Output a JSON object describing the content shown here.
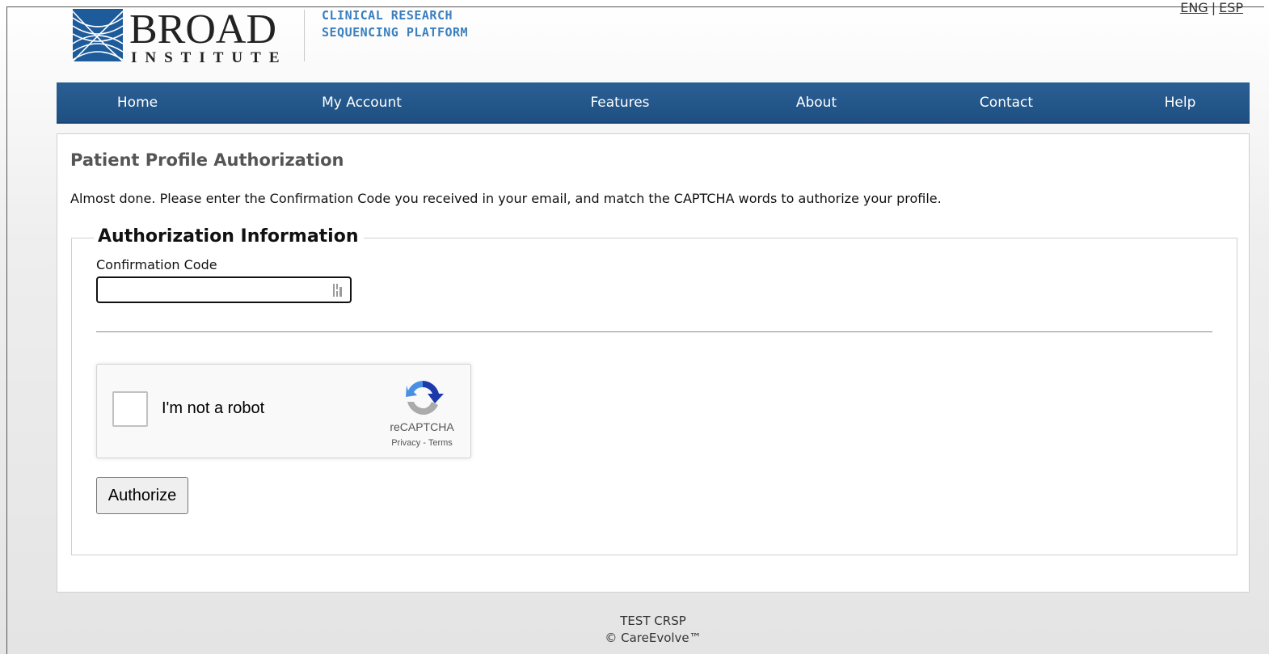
{
  "header": {
    "logo_word": "BROAD",
    "logo_subword": "INSTITUTE",
    "platform_line1": "CLINICAL RESEARCH",
    "platform_line2": "SEQUENCING PLATFORM",
    "lang_eng": "ENG",
    "lang_separator": "|",
    "lang_esp": "ESP"
  },
  "nav": {
    "items": [
      {
        "label": "Home"
      },
      {
        "label": "My Account"
      },
      {
        "label": "Features"
      },
      {
        "label": "About"
      },
      {
        "label": "Contact"
      },
      {
        "label": "Help"
      }
    ]
  },
  "main": {
    "title": "Patient Profile Authorization",
    "intro": "Almost done. Please enter the Confirmation Code you received in your email, and match the CAPTCHA words to authorize your profile.",
    "fieldset_legend": "Authorization Information",
    "confirmation_label": "Confirmation Code",
    "confirmation_value": "",
    "input_badge_icon": "password-manager-icon",
    "recaptcha": {
      "label": "I'm not a robot",
      "brand": "reCAPTCHA",
      "privacy": "Privacy",
      "separator": " - ",
      "terms": "Terms",
      "logo_icon": "recaptcha-logo-icon"
    },
    "authorize_label": "Authorize"
  },
  "footer": {
    "line1": "TEST CRSP",
    "line2": "© CareEvolve™"
  },
  "colors": {
    "nav_bg": "#2b5f93",
    "platform_text": "#3a7fbf",
    "logo_blue": "#1e5b9a"
  }
}
